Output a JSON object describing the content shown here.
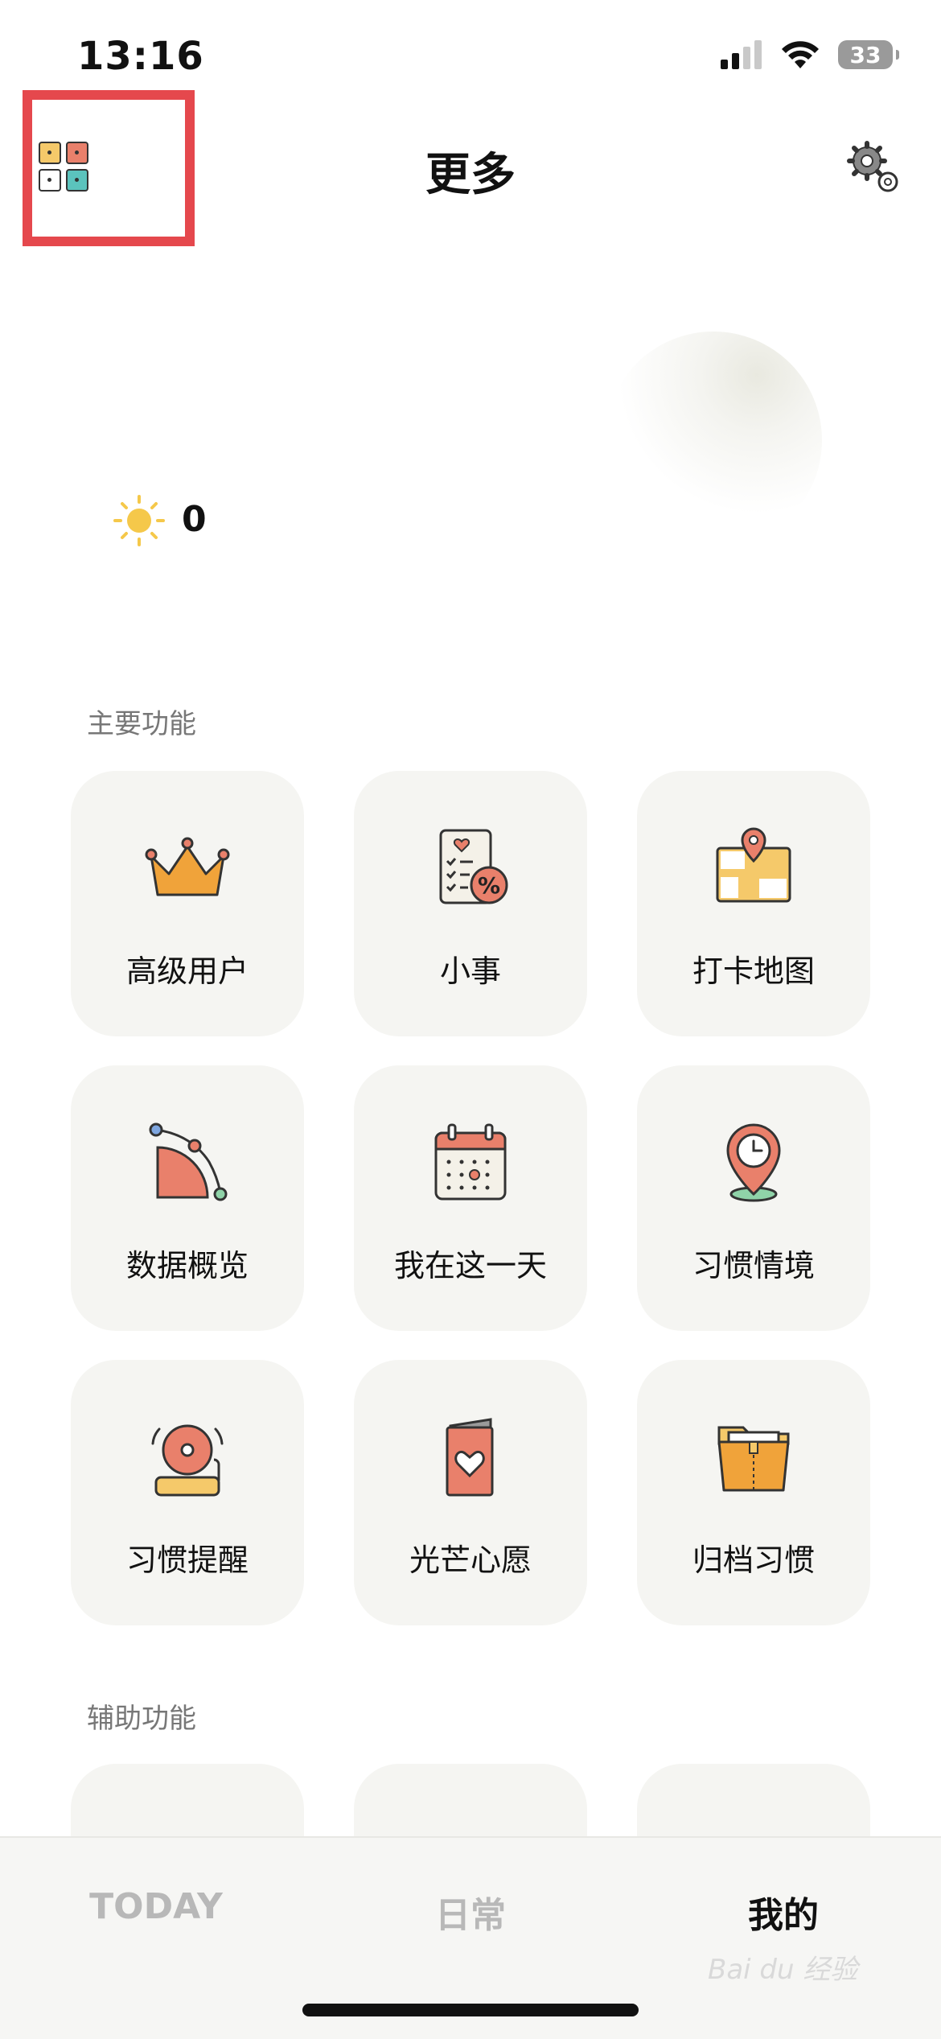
{
  "status_bar": {
    "time": "13:16",
    "battery": "33"
  },
  "header": {
    "title": "更多"
  },
  "profile": {
    "sun_count": "0"
  },
  "sections": {
    "main_label": "主要功能",
    "aux_label": "辅助功能"
  },
  "main_features": [
    {
      "label": "高级用户",
      "icon": "crown-icon"
    },
    {
      "label": "小事",
      "icon": "checklist-icon"
    },
    {
      "label": "打卡地图",
      "icon": "map-pin-icon"
    },
    {
      "label": "数据概览",
      "icon": "chart-icon"
    },
    {
      "label": "我在这一天",
      "icon": "calendar-icon"
    },
    {
      "label": "习惯情境",
      "icon": "location-clock-icon"
    },
    {
      "label": "习惯提醒",
      "icon": "alarm-bell-icon"
    },
    {
      "label": "光芒心愿",
      "icon": "heart-card-icon"
    },
    {
      "label": "归档习惯",
      "icon": "folder-icon"
    }
  ],
  "tabs": [
    {
      "label": "TODAY",
      "active": false
    },
    {
      "label": "日常",
      "active": false
    },
    {
      "label": "我的",
      "active": true
    }
  ],
  "watermark": "Bai du 经验",
  "colors": {
    "accent_red": "#e5484d",
    "tile_bg": "#f5f5f2",
    "inactive_tab": "#b8b8b8"
  }
}
